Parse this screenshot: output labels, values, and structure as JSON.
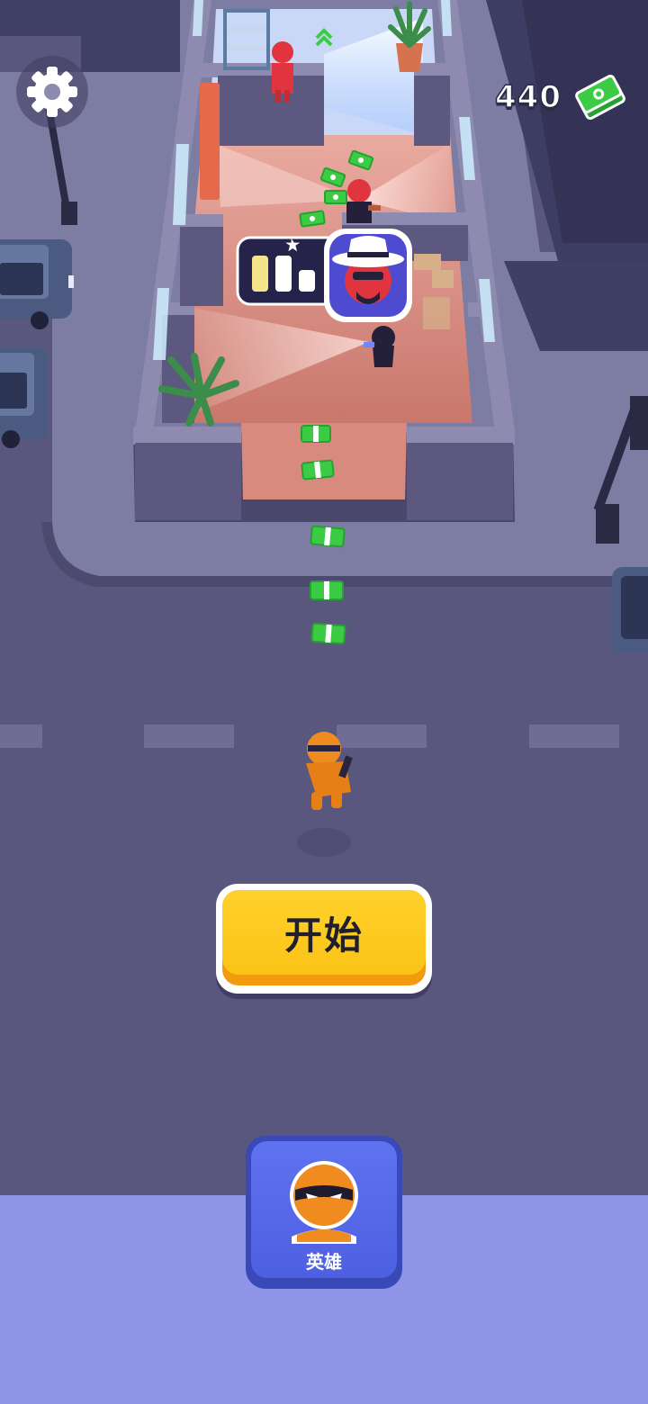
{
  "currency": {
    "amount": "440",
    "icon": "cash-stack-icon"
  },
  "settings": {
    "icon": "gear-icon"
  },
  "target": {
    "icon": "boss-white-hat-icon",
    "progress_icon": "progress-bars-icon"
  },
  "start_button": {
    "label": "开始"
  },
  "hero_button": {
    "label": "英雄",
    "icon": "ninja-hero-avatar-icon"
  },
  "colors": {
    "accent_yellow": "#fbc317",
    "accent_blue": "#5366e8",
    "cash_green": "#3ccb45",
    "floor_pink": "#dc8d82",
    "street": "#5a577f",
    "panel_lavender": "#8f95e6"
  }
}
